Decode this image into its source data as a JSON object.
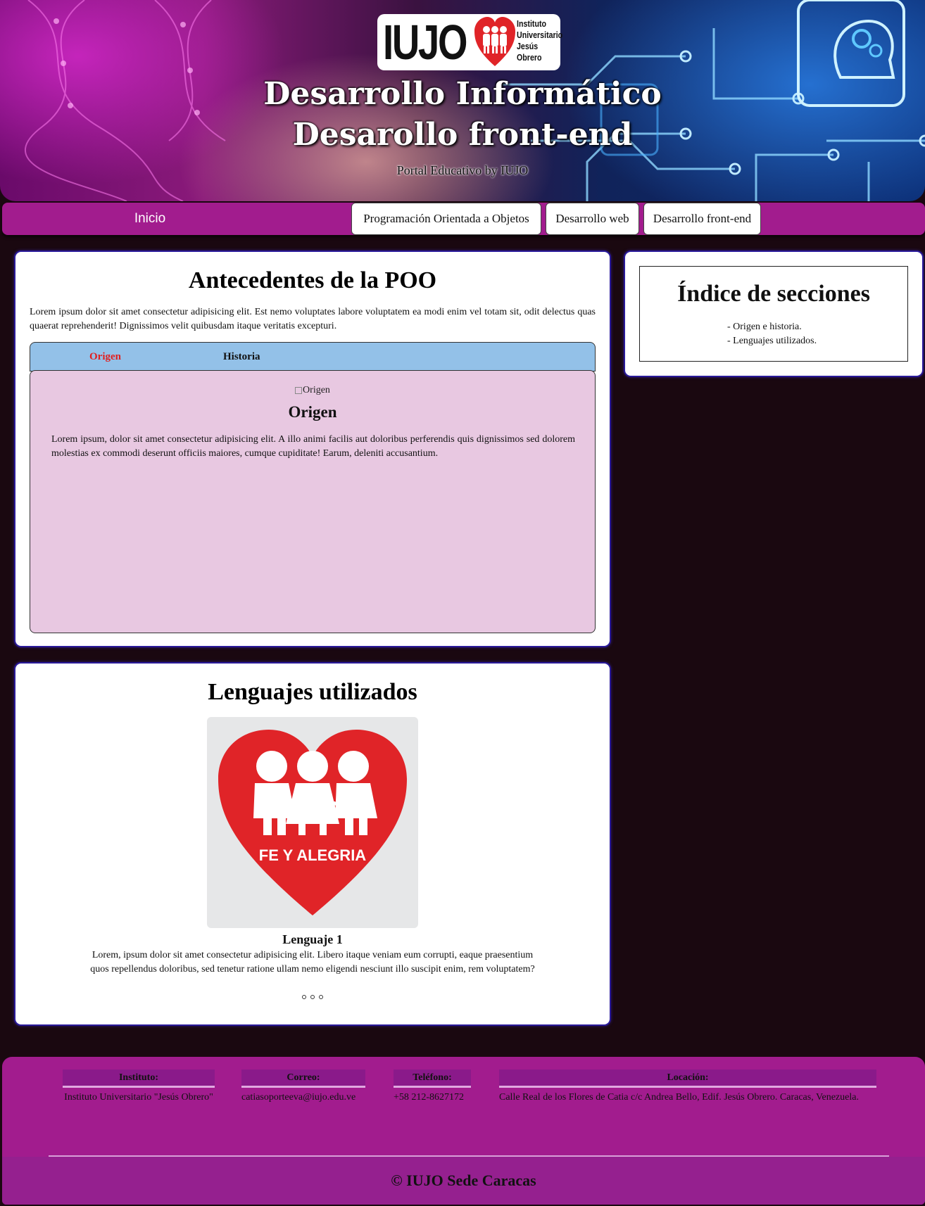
{
  "header": {
    "logo_text": "IUJO",
    "logo_subtitle": [
      "Instituto",
      "Universitario",
      "Jesús",
      "Obrero"
    ],
    "title_line1": "Desarrollo Informático",
    "title_line2": "Desarollo front-end",
    "subtitle": "Portal Educativo by IUJO"
  },
  "nav": {
    "home": "Inicio",
    "items": [
      "Programación Orientada a Objetos",
      "Desarrollo web",
      "Desarrollo front-end"
    ]
  },
  "poo": {
    "title": "Antecedentes de la POO",
    "intro": "Lorem ipsum dolor sit amet consectetur adipisicing elit. Est nemo voluptates labore voluptatem ea modi enim vel totam sit, odit delectus quas quaerat reprehenderit! Dignissimos velit quibusdam itaque veritatis excepturi.",
    "tabs": [
      "Origen",
      "Historia"
    ],
    "panel": {
      "image_alt": "Origen",
      "heading": "Origen",
      "text": "Lorem ipsum, dolor sit amet consectetur adipisicing elit. A illo animi facilis aut doloribus perferendis quis dignissimos sed dolorem molestias ex commodi deserunt officiis maiores, cumque cupiditate! Earum, deleniti accusantium."
    }
  },
  "lenguajes": {
    "title": "Lenguajes utilizados",
    "image_caption": "FE Y ALEGRIA",
    "item_title": "Lenguaje 1",
    "item_text": "Lorem, ipsum dolor sit amet consectetur adipisicing elit. Libero itaque veniam eum corrupti, eaque praesentium quos repellendus doloribus, sed tenetur ratione ullam nemo eligendi nesciunt illo suscipit enim, rem voluptatem?"
  },
  "indice": {
    "title": "Índice de secciones",
    "items": [
      "- Origen e historia.",
      "- Lenguajes utilizados."
    ]
  },
  "footer": {
    "instituto_label": "Instituto:",
    "instituto_value": "Instituto Universitario \"Jesús Obrero\"",
    "correo_label": "Correo:",
    "correo_value": "catiasoporteeva@iujo.edu.ve",
    "telefono_label": "Teléfono:",
    "telefono_value": "+58 212-8627172",
    "locacion_label": "Locación:",
    "locacion_value": "Calle Real de los Flores de Catia c/c Andrea Bello, Edif. Jesús Obrero. Caracas, Venezuela.",
    "copyright": "© IUJO Sede Caracas"
  },
  "colors": {
    "nav_bg": "#a21c8e",
    "tab_bar": "#93c1e8",
    "tab_active": "#e02020",
    "panel_bg": "#e8c8e1",
    "card_border": "#2a1a9a",
    "page_bg": "#1a0810",
    "heart_red": "#e02428"
  }
}
